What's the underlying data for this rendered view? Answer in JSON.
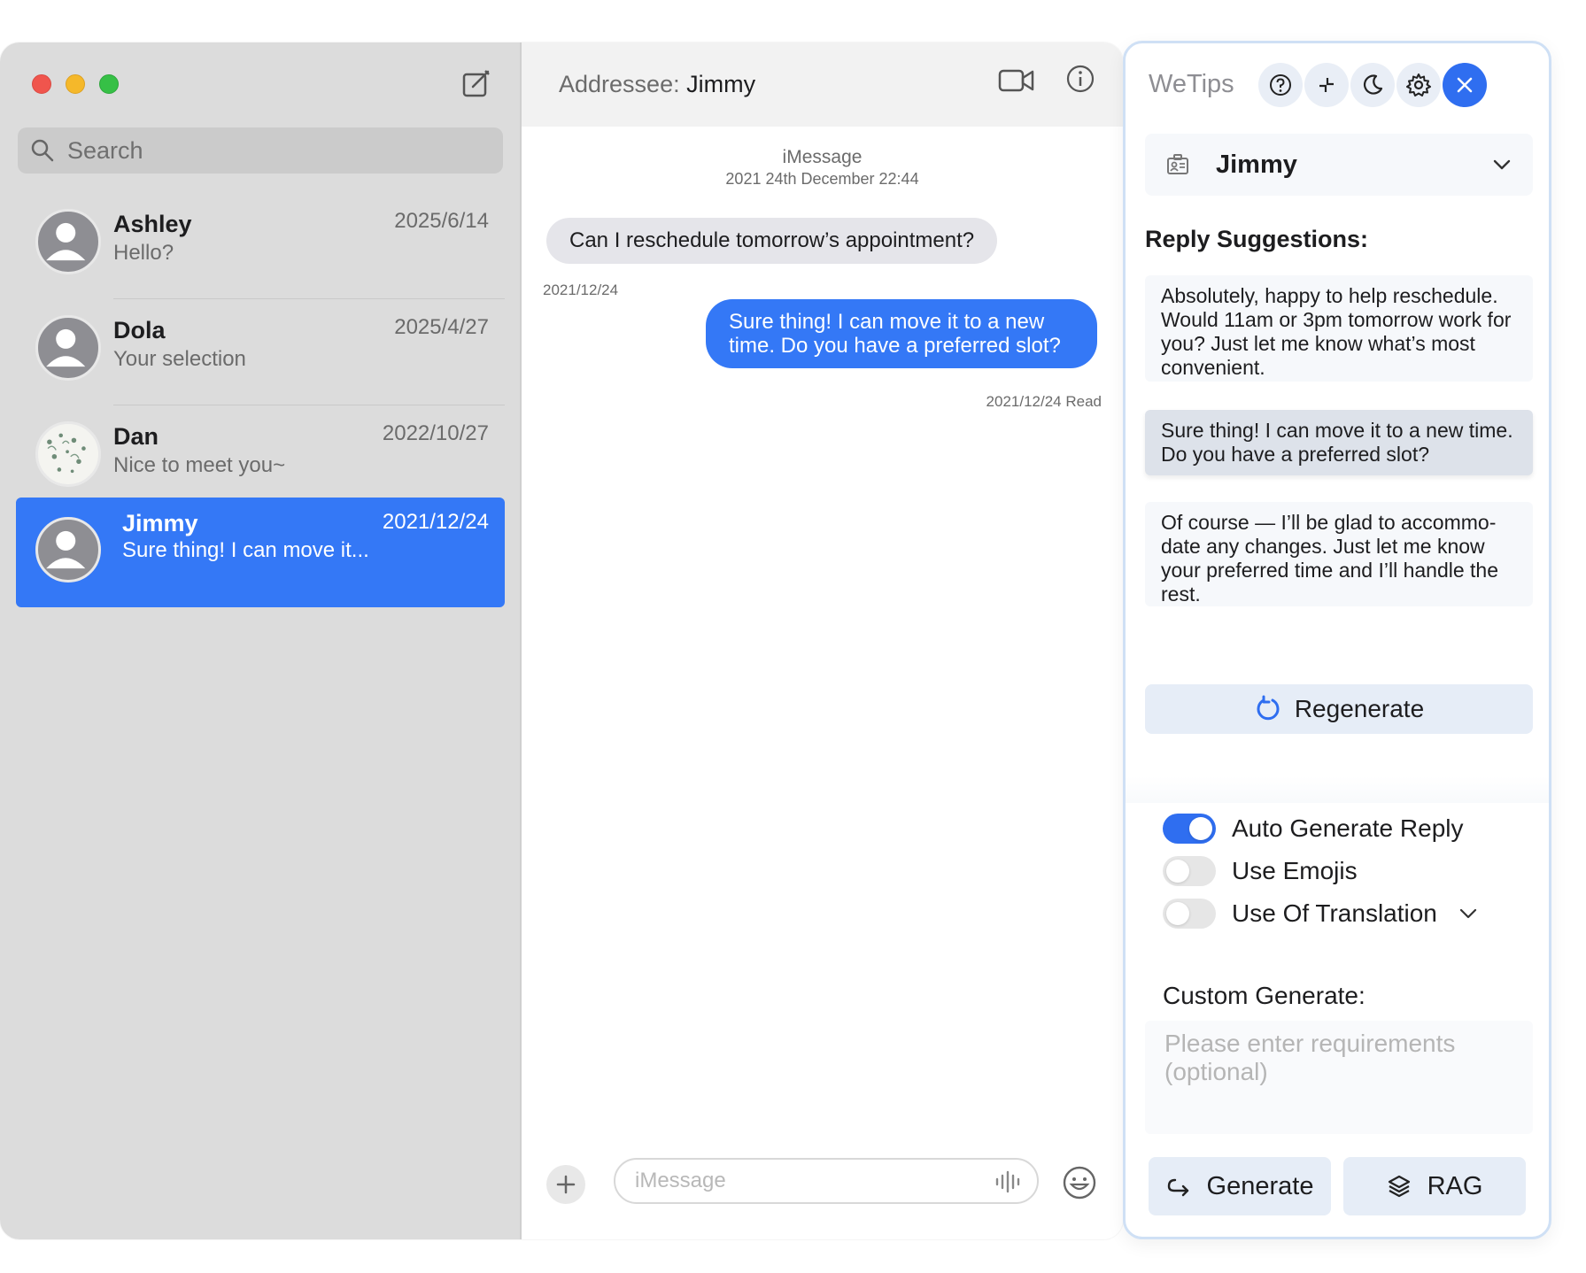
{
  "sidebar": {
    "search_placeholder": "Search",
    "conversations": [
      {
        "name": "Ashley",
        "preview": "Hello?",
        "date": "2025/6/14"
      },
      {
        "name": "Dola",
        "preview": "Your selection",
        "date": "2025/4/27"
      },
      {
        "name": "Dan",
        "preview": "Nice to meet you~",
        "date": "2022/10/27"
      },
      {
        "name": "Jimmy",
        "preview": "Sure thing! I can move it...",
        "date": "2021/12/24",
        "active": true
      }
    ]
  },
  "chat": {
    "addressee_label": "Addressee:",
    "addressee_name": "Jimmy",
    "service": "iMessage",
    "timestamp": "2021 24th December 22:44",
    "incoming": {
      "text": "Can I reschedule tomorrow’s appointment?",
      "date": "2021/12/24"
    },
    "outgoing": {
      "text": "Sure thing! I can move it to a new time. Do you have a preferred slot?",
      "status": "2021/12/24 Read"
    },
    "composer_placeholder": "iMessage"
  },
  "panel": {
    "title": "WeTips",
    "contact": "Jimmy",
    "suggestions_heading": "Reply Suggestions:",
    "suggestions": [
      "Absolutely, happy to help reschedule. Would 11am or 3pm tomorrow work for you? Just let me know what’s most convenient.",
      "Sure thing! I can move it to a new time. Do you have a preferred slot?",
      "Of course — I’ll be glad to accommo-date any changes. Just let me know your preferred time and I’ll handle the rest."
    ],
    "regenerate_label": "Regenerate",
    "toggles": [
      {
        "label": "Auto Generate Reply",
        "on": true
      },
      {
        "label": "Use Emojis",
        "on": false
      },
      {
        "label": "Use Of Translation",
        "on": false
      }
    ],
    "custom_heading": "Custom Generate:",
    "custom_placeholder": "Please enter requirements (optional)",
    "generate_label": "Generate",
    "rag_label": "RAG"
  },
  "colors": {
    "accent": "#3478f6",
    "sidebar_bg": "#dcdcdc",
    "bubble_in": "#e5e5ea",
    "panel_button": "#e6edf7"
  }
}
